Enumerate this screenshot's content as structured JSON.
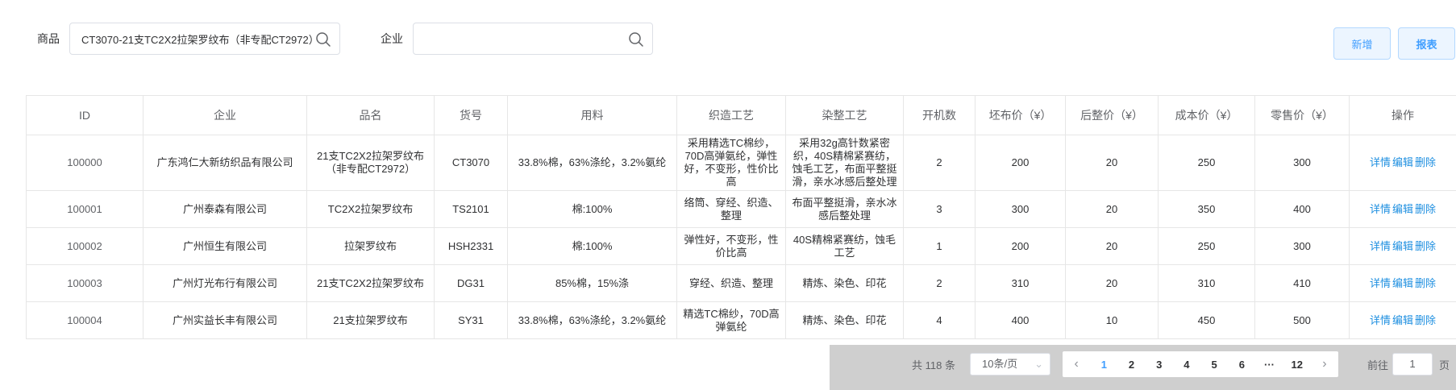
{
  "filters": {
    "product_label": "商品",
    "product_value": "CT3070-21支TC2X2拉架罗纹布（非专配CT2972）",
    "company_label": "企业",
    "company_value": ""
  },
  "toolbar": {
    "add_label": "新增",
    "report_label": "报表"
  },
  "table": {
    "columns": [
      "ID",
      "企业",
      "品名",
      "货号",
      "用料",
      "织造工艺",
      "染整工艺",
      "开机数",
      "坯布价（¥）",
      "后整价（¥）",
      "成本价（¥）",
      "零售价（¥）",
      "操作"
    ],
    "rows": [
      {
        "id": "100000",
        "company": "广东鸿仁大新纺织品有限公司",
        "name": "21支TC2X2拉架罗纹布（非专配CT2972）",
        "code": "CT3070",
        "material": "33.8%棉，63%涤纶，3.2%氨纶",
        "weaving": "采用精选TC棉纱，70D高弹氨纶，弹性好，不变形，性价比高",
        "dyeing": "采用32g高针数紧密织，40S精棉紧赛纺，蚀毛工艺，布面平整挺滑，亲水冰感后整处理",
        "machines": "2",
        "grey_price": "200",
        "finish_price": "20",
        "cost_price": "250",
        "retail_price": "300"
      },
      {
        "id": "100001",
        "company": "广州泰森有限公司",
        "name": "TC2X2拉架罗纹布",
        "code": "TS2101",
        "material": "棉:100%",
        "weaving": "络筒、穿经、织造、整理",
        "dyeing": "布面平整挺滑，亲水冰感后整处理",
        "machines": "3",
        "grey_price": "300",
        "finish_price": "20",
        "cost_price": "350",
        "retail_price": "400"
      },
      {
        "id": "100002",
        "company": "广州恒生有限公司",
        "name": "拉架罗纹布",
        "code": "HSH2331",
        "material": "棉:100%",
        "weaving": "弹性好，不变形，性价比高",
        "dyeing": "40S精棉紧赛纺，蚀毛工艺",
        "machines": "1",
        "grey_price": "200",
        "finish_price": "20",
        "cost_price": "250",
        "retail_price": "300"
      },
      {
        "id": "100003",
        "company": "广州灯光布行有限公司",
        "name": "21支TC2X2拉架罗纹布",
        "code": "DG31",
        "material": "85%棉，15%涤",
        "weaving": "穿经、织造、整理",
        "dyeing": "精炼、染色、印花",
        "machines": "2",
        "grey_price": "310",
        "finish_price": "20",
        "cost_price": "310",
        "retail_price": "410"
      },
      {
        "id": "100004",
        "company": "广州实益长丰有限公司",
        "name": "21支拉架罗纹布",
        "code": "SY31",
        "material": "33.8%棉，63%涤纶，3.2%氨纶",
        "weaving": "精选TC棉纱，70D高弹氨纶",
        "dyeing": "精炼、染色、印花",
        "machines": "4",
        "grey_price": "400",
        "finish_price": "10",
        "cost_price": "450",
        "retail_price": "500"
      }
    ],
    "actions": {
      "detail": "详情",
      "edit": "编辑",
      "delete": "删除"
    }
  },
  "pagination": {
    "total_text": "共 118 条",
    "page_size": "10条/页",
    "pages": [
      "1",
      "2",
      "3",
      "4",
      "5",
      "6",
      "···",
      "12"
    ],
    "current_page": "1",
    "goto_label": "前往",
    "goto_value": "1",
    "goto_suffix": "页"
  },
  "colors": {
    "accent": "#409eff",
    "action_link": "#1e8fe0",
    "border": "#e6e6e6",
    "pager_bar": "#cfcfcf"
  }
}
